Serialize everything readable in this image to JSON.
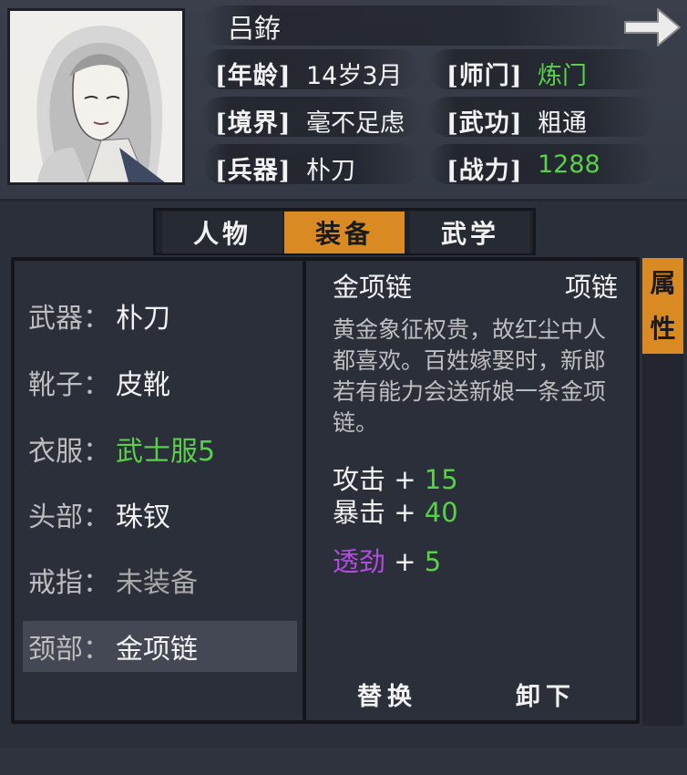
{
  "character": {
    "name": "吕銌",
    "age_label": "[年龄]",
    "age": "14岁3月",
    "sect_label": "[师门]",
    "sect": "炼门",
    "realm_label": "[境界]",
    "realm": "毫不足虑",
    "martial_label": "[武功]",
    "martial": "粗通",
    "weapon_label": "[兵器]",
    "weapon": "朴刀",
    "power_label": "[战力]",
    "power": "1288"
  },
  "tabs": [
    {
      "label": "人物"
    },
    {
      "label": "装备"
    },
    {
      "label": "武学"
    }
  ],
  "equipment_slots": [
    {
      "label": "武器：",
      "value": "朴刀"
    },
    {
      "label": "靴子：",
      "value": "皮靴"
    },
    {
      "label": "衣服：",
      "value": "武士服5"
    },
    {
      "label": "头部：",
      "value": "珠钗"
    },
    {
      "label": "戒指：",
      "value": "未装备"
    },
    {
      "label": "颈部：",
      "value": "金项链"
    }
  ],
  "item_detail": {
    "name": "金项链",
    "type": "项链",
    "description": "黄金象征权贵，故红尘中人都喜欢。百姓嫁娶时，新郎若有能力会送新娘一条金项链。",
    "stats": [
      {
        "label": "攻击",
        "op": " + ",
        "value": "15"
      },
      {
        "label": "暴击",
        "op": " + ",
        "value": "40"
      },
      {
        "label": "透劲",
        "op": " + ",
        "value": "5"
      }
    ]
  },
  "side_tab": {
    "chars": [
      "属",
      "性"
    ]
  },
  "actions": {
    "replace": "替换",
    "unequip": "卸下"
  },
  "colors": {
    "accent": "#d98a22",
    "positive": "#5ad04a",
    "special": "#b24be0"
  },
  "icons": {
    "next": "arrow-right-icon"
  }
}
